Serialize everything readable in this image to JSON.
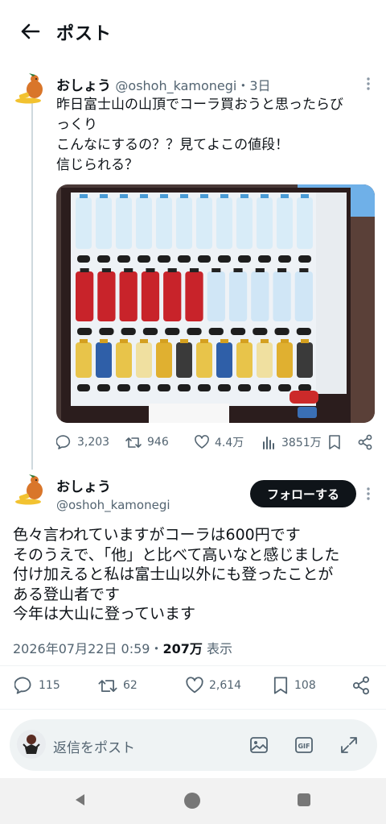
{
  "header": {
    "title": "ポスト"
  },
  "parent_post": {
    "display_name": "おしょう",
    "meta": "@oshoh_kamonegi・3日",
    "lines": [
      "昨日富士山の山頂でコーラ買おうと思ったらび",
      "っくり",
      "こんなにするの？？見てよこの値段！",
      "信じられる？"
    ],
    "stats": {
      "replies": "3,203",
      "reposts": "946",
      "likes": "4.4万",
      "views": "3851万"
    }
  },
  "main_post": {
    "display_name": "おしょう",
    "handle": "@oshoh_kamonegi",
    "follow_label": "フォローする",
    "lines": [
      "色々言われていますがコーラは600円です",
      "そのうえで、「他」と比べて高いなと感じました",
      "付け加えると私は富士山以外にも登ったことが",
      "ある登山者です",
      "今年は大山に登っています"
    ],
    "timestamp": "2026年07月22日 0:59・",
    "views_count": "207万",
    "views_label": " 表示",
    "stats": {
      "replies": "115",
      "reposts": "62",
      "likes": "2,614",
      "bookmarks": "108"
    }
  },
  "reply_bar": {
    "placeholder": "返信をポスト"
  },
  "colors": {
    "text": "#0f1419",
    "secondary": "#536471",
    "divider": "#eff3f4"
  }
}
